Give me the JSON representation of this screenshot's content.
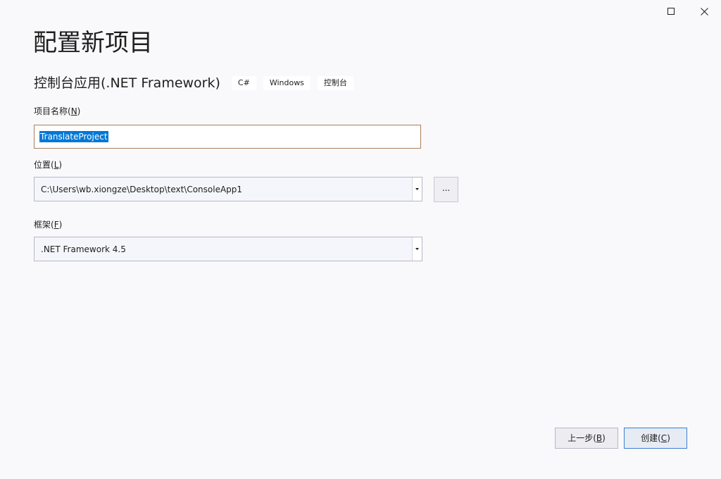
{
  "window": {
    "maximize_icon": "maximize-icon",
    "close_icon": "close-icon"
  },
  "header": {
    "title": "配置新项目",
    "template_name": "控制台应用(.NET Framework)",
    "tags": [
      "C#",
      "Windows",
      "控制台"
    ]
  },
  "project_name": {
    "label": "项目名称(",
    "access_key": "N",
    "label_end": ")",
    "value": "TranslateProject"
  },
  "location": {
    "label": "位置(",
    "access_key": "L",
    "label_end": ")",
    "value": "C:\\Users\\wb.xiongze\\Desktop\\text\\ConsoleApp1",
    "browse_label": "..."
  },
  "framework": {
    "label": "框架(",
    "access_key": "F",
    "label_end": ")",
    "value": ".NET Framework 4.5"
  },
  "footer": {
    "back": {
      "label": "上一步(",
      "access_key": "B",
      "label_end": ")"
    },
    "create": {
      "label": "创建(",
      "access_key": "C",
      "label_end": ")"
    }
  },
  "colors": {
    "background": "#f9f9fc",
    "selection": "#0078d7",
    "focus_border": "#a9805a",
    "primary_button_border": "#3c7fd1"
  }
}
